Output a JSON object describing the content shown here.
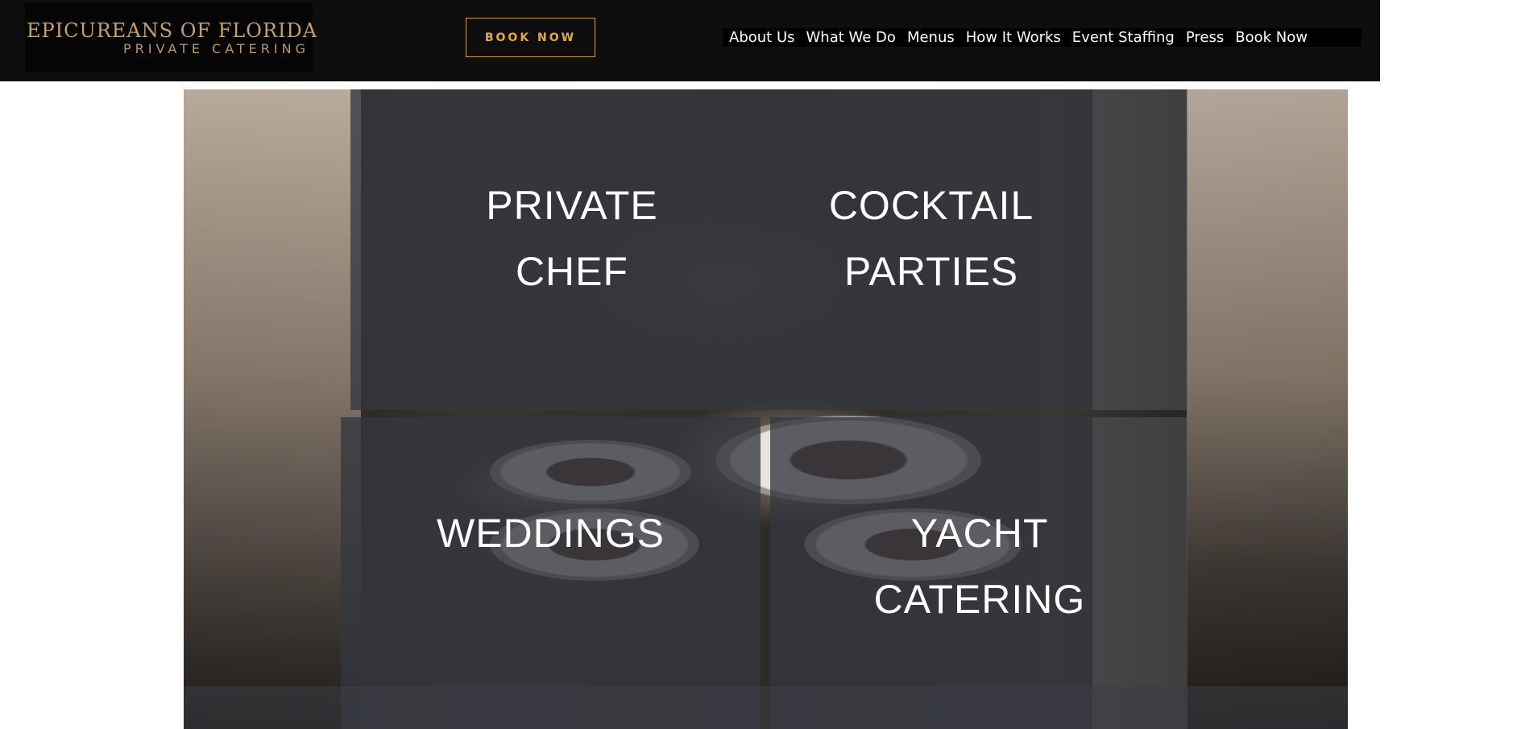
{
  "header": {
    "logo": {
      "title": "EPICUREANS OF FLORIDA",
      "subtitle": "PRIVATE CATERING"
    },
    "book_button_label": "BOOK NOW",
    "nav": [
      {
        "label": "About Us"
      },
      {
        "label": "What We Do"
      },
      {
        "label": "Menus"
      },
      {
        "label": "How It Works"
      },
      {
        "label": "Event Staffing"
      },
      {
        "label": "Press"
      },
      {
        "label": "Book Now"
      }
    ]
  },
  "hero": {
    "tiles": [
      {
        "line1": "PRIVATE",
        "line2": "CHEF"
      },
      {
        "line1": "COCKTAIL",
        "line2": "PARTIES"
      },
      {
        "line1": "WEDDINGS",
        "line2": ""
      },
      {
        "line1": "YACHT",
        "line2": "CATERING"
      }
    ]
  },
  "colors": {
    "header_bg": "#0e0e0e",
    "logo_gold": "#c4a06a",
    "button_gold": "#e2aa44",
    "panel_overlay": "#343740"
  }
}
